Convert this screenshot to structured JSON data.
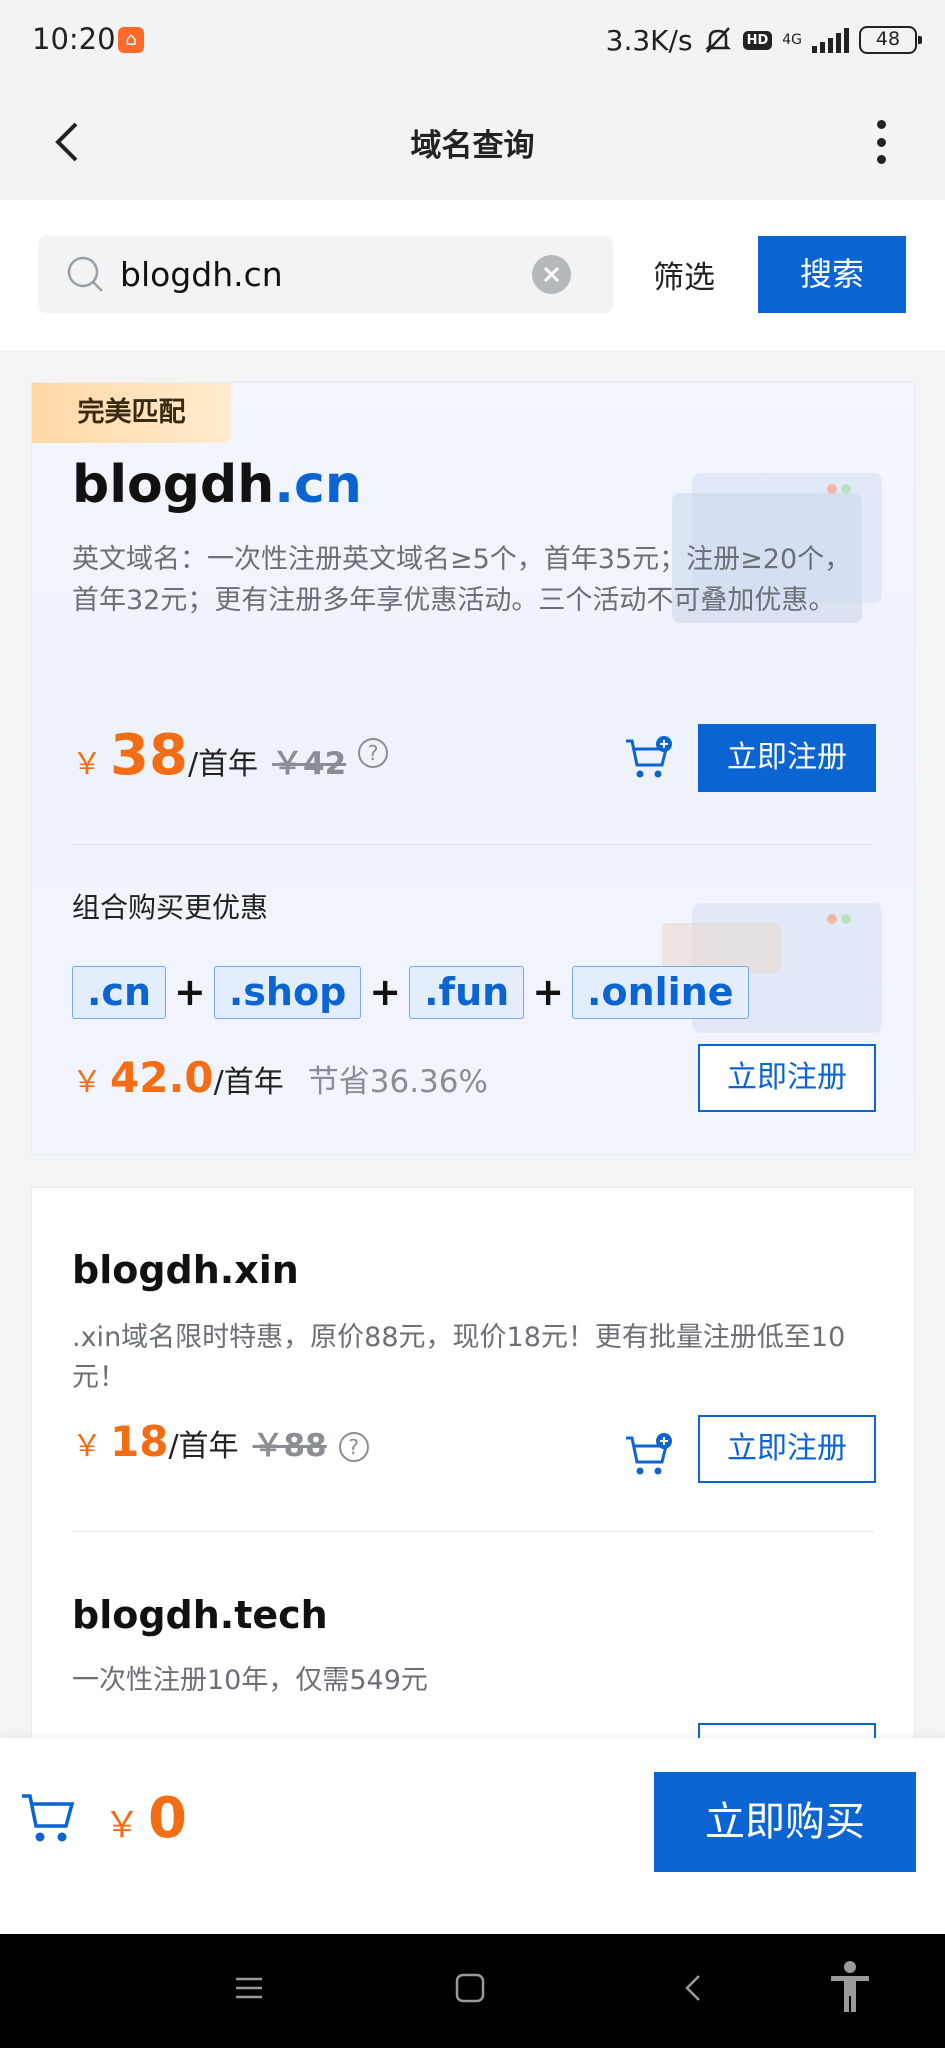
{
  "status_bar": {
    "time": "10:20",
    "speed": "3.3K/s",
    "hd": "HD",
    "network": "4G",
    "battery": "48"
  },
  "header": {
    "title": "域名查询"
  },
  "search": {
    "value": "blogdh.cn",
    "filter_label": "筛选",
    "search_label": "搜索"
  },
  "results": [
    {
      "tag": "完美匹配",
      "name": "blogdh",
      "tld": ".cn",
      "description": "英文域名：一次性注册英文域名≥5个，首年35元；注册≥20个，首年32元；更有注册多年享优惠活动。三个活动不可叠加优惠。",
      "currency": "￥",
      "price": "38",
      "unit": "/首年",
      "original_price": "￥42",
      "register_label": "立即注册",
      "combo": {
        "title": "组合购买更优惠",
        "tlds": [
          ".cn",
          ".shop",
          ".fun",
          ".online"
        ],
        "plus": "+",
        "price": "42.0",
        "unit": "/首年",
        "saving": "节省36.36%",
        "register_label": "立即注册"
      }
    },
    {
      "domain": "blogdh.xin",
      "description": ".xin域名限时特惠，原价88元，现价18元！更有批量注册低至10元！",
      "currency": "￥",
      "price": "18",
      "unit": "/首年",
      "original_price": "￥88",
      "register_label": "立即注册"
    },
    {
      "domain": "blogdh.tech",
      "description": "一次性注册10年，仅需549元"
    }
  ],
  "bottom_bar": {
    "currency": "￥",
    "total": "0",
    "buy_label": "立即购买"
  },
  "colors": {
    "primary": "#0a64d2",
    "price": "#f26d14",
    "tag_bg": "#ffd8a6"
  },
  "icons": [
    "back-icon",
    "more-icon",
    "search-icon",
    "clear-icon",
    "help-icon",
    "cart-add-icon",
    "cart-icon",
    "menu-icon",
    "home-icon",
    "nav-back-icon",
    "accessibility-icon"
  ]
}
